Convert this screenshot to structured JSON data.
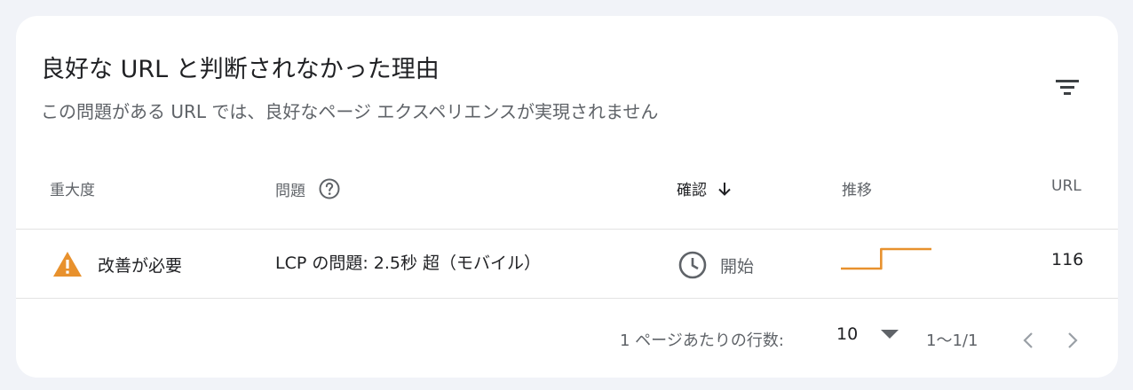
{
  "card": {
    "title": "良好な URL と判断されなかった理由",
    "subtitle": "この問題がある URL では、良好なページ エクスペリエンスが実現されません",
    "filter_icon": "filter-icon"
  },
  "table": {
    "columns": [
      {
        "label": "重大度"
      },
      {
        "label": "問題",
        "icon": "help-circle-icon"
      },
      {
        "label": "確認",
        "icon": "arrow-down-icon",
        "sorted": "desc"
      },
      {
        "label": "推移"
      },
      {
        "label": "URL"
      }
    ],
    "rows": [
      {
        "severity": "改善が必要",
        "severity_icon": "warning-icon",
        "severity_color": "#e8912d",
        "issue": "LCP の問題: 2.5秒 超（モバイル）",
        "validation": "開始",
        "validation_icon": "clock-icon",
        "trend": [
          0,
          0,
          0,
          0,
          1,
          1,
          1,
          1,
          1,
          1
        ],
        "trend_color": "#e8912d",
        "urls": "116"
      }
    ]
  },
  "footer": {
    "rows_per_page_label": "1 ページあたりの行数:",
    "rows_per_page_value": "10",
    "range": "1〜1/1",
    "prev_icon": "chevron-left-icon",
    "next_icon": "chevron-right-icon"
  }
}
